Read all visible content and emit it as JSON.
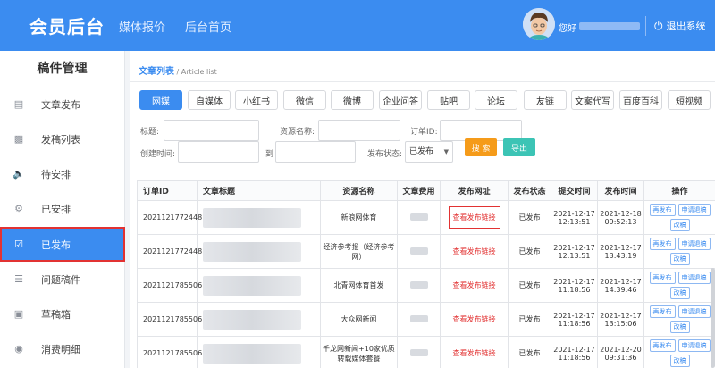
{
  "header": {
    "brand": "会员后台",
    "nav": [
      "媒体报价",
      "后台首页"
    ],
    "user_prefix": "您好",
    "logout": "退出系统"
  },
  "sidebar": {
    "title": "稿件管理",
    "items": [
      {
        "label": "文章发布",
        "icon": "document-icon"
      },
      {
        "label": "发稿列表",
        "icon": "clipboard-icon"
      },
      {
        "label": "待安排",
        "icon": "speaker-icon"
      },
      {
        "label": "已安排",
        "icon": "file-settings-icon"
      },
      {
        "label": "已发布",
        "icon": "file-check-icon",
        "active": true
      },
      {
        "label": "问题稿件",
        "icon": "file-list-icon"
      },
      {
        "label": "草稿箱",
        "icon": "inbox-icon"
      },
      {
        "label": "消费明细",
        "icon": "coins-icon"
      }
    ]
  },
  "breadcrumb": {
    "title": "文章列表",
    "sep": " / ",
    "sub": "Article list"
  },
  "tabs": [
    "网媒",
    "自媒体",
    "小红书",
    "微信",
    "微博",
    "企业问答",
    "贴吧",
    "论坛",
    "友链",
    "文案代写",
    "百度百科",
    "短视频"
  ],
  "filters": {
    "title_label": "标题:",
    "resource_label": "资源名称:",
    "order_label": "订单ID:",
    "created_label": "创建时间:",
    "to_label": "到",
    "status_label": "发布状态:",
    "status_value": "已发布",
    "search_btn": "搜 索",
    "export_btn": "导出"
  },
  "table": {
    "headers": [
      "订单ID",
      "文章标题",
      "资源名称",
      "文章费用",
      "发布网址",
      "发布状态",
      "提交时间",
      "发布时间",
      "操作"
    ],
    "rows": [
      {
        "id": "2021121772448",
        "resource": "新浪网体育",
        "link": "查看发布链接",
        "status": "已发布",
        "submit": "2021-12-17 12:13:51",
        "publish": "2021-12-18 09:52:13",
        "highlight": true
      },
      {
        "id": "2021121772448",
        "resource": "经济参考报（经济参考网）",
        "link": "查看发布链接",
        "status": "已发布",
        "submit": "2021-12-17 12:13:51",
        "publish": "2021-12-17 13:43:19"
      },
      {
        "id": "2021121785506",
        "resource": "北青网体育首发",
        "link": "查看发布链接",
        "status": "已发布",
        "submit": "2021-12-17 11:18:56",
        "publish": "2021-12-17 14:39:46"
      },
      {
        "id": "2021121785506",
        "resource": "大众网新闻",
        "link": "查看发布链接",
        "status": "已发布",
        "submit": "2021-12-17 11:18:56",
        "publish": "2021-12-17 13:15:06"
      },
      {
        "id": "2021121785506",
        "resource": "千龙网新闻+10家优质转载媒体套餐",
        "link": "查看发布链接",
        "status": "已发布",
        "submit": "2021-12-17 11:18:56",
        "publish": "2021-12-20 09:31:36"
      }
    ],
    "ops": [
      "再发布",
      "申请退稿",
      "改稿"
    ]
  }
}
